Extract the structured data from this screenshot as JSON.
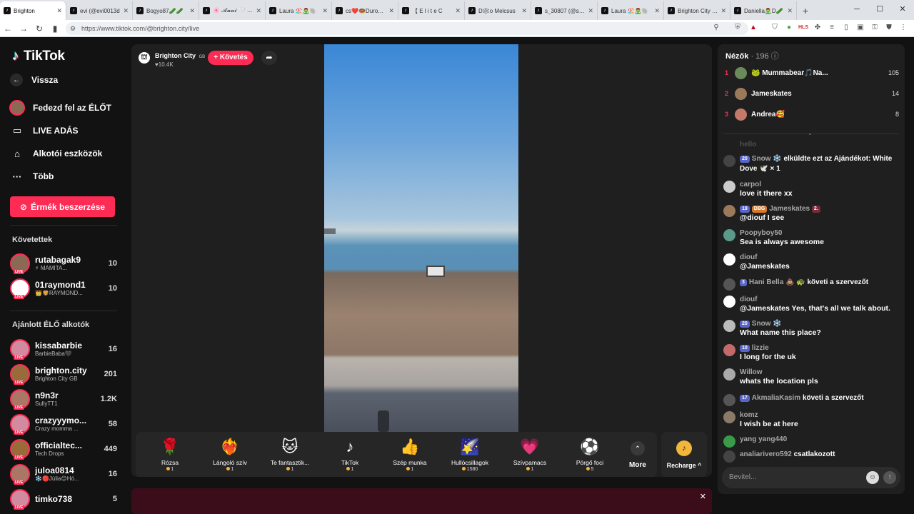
{
  "browser": {
    "tabs": [
      {
        "title": "Brighton",
        "active": true
      },
      {
        "title": "evi (@evi0013d"
      },
      {
        "title": "Bogyo87🥒🥒"
      },
      {
        "title": "🌸 𝓐𝓷𝓷𝓲 🤍 🌸"
      },
      {
        "title": "Laura 🏖️🧟‍♂️🐘"
      },
      {
        "title": "cs❤️🍩Duroka❤️"
      },
      {
        "title": "【 E l i t e C"
      },
      {
        "title": "D🕸️o Melcsus"
      },
      {
        "title": "s_30807 (@s_30"
      },
      {
        "title": "Laura 🏖️🧟‍♂️🐘"
      },
      {
        "title": "Brighton City oa"
      },
      {
        "title": "Daniella🧟‍♂️D🥒"
      }
    ],
    "url": "https://www.tiktok.com/@brighton.city/live"
  },
  "sidebar": {
    "logo": "TikTok",
    "back": "Vissza",
    "explore": "Fedezd fel az ÉLŐT",
    "live": "LIVE ADÁS",
    "creator_tools": "Alkotói eszközök",
    "more": "Több",
    "coins_button": "Érmék beszerzése",
    "following_title": "Követettek",
    "following": [
      {
        "name": "rutabagak9",
        "sub": "⚡ MAMITA...",
        "count": "10"
      },
      {
        "name": "01raymond1",
        "sub": "👑🦁RAYMOND...",
        "count": "10"
      }
    ],
    "recommended_title": "Ajánlott ÉLŐ alkotók",
    "recommended": [
      {
        "name": "kissabarbie",
        "sub": "BarbieBaba🖤",
        "count": "16"
      },
      {
        "name": "brighton.city",
        "sub": "Brighton City GB",
        "count": "201"
      },
      {
        "name": "n9n3r",
        "sub": "SullyTT1",
        "count": "1.2K"
      },
      {
        "name": "crazyyymo...",
        "sub": "Crazy momma ...",
        "count": "58"
      },
      {
        "name": "officialtec...",
        "sub": "Tech Drops",
        "count": "449"
      },
      {
        "name": "juloa0814",
        "sub": "❄️🔴Júlia😊Hó...",
        "count": "16"
      },
      {
        "name": "timko738",
        "sub": "",
        "count": "5"
      }
    ]
  },
  "stream": {
    "name": "Brighton City",
    "flag": "GB",
    "likes": "10.4K",
    "follow": "+ Követés"
  },
  "gifts": [
    {
      "name": "Rózsa",
      "icon": "🌹",
      "price": "1"
    },
    {
      "name": "Lángoló szív",
      "icon": "❤️‍🔥",
      "price": "1"
    },
    {
      "name": "Te fantasztik...",
      "icon": "🐱",
      "price": "1"
    },
    {
      "name": "TikTok",
      "icon": "♪",
      "price": "1"
    },
    {
      "name": "Szép munka",
      "icon": "👍",
      "price": "1"
    },
    {
      "name": "Hullócsillagok",
      "icon": "🌠",
      "price": "1580"
    },
    {
      "name": "Szívpamacs",
      "icon": "💗",
      "price": "1"
    },
    {
      "name": "Pörgő foci",
      "icon": "⚽",
      "price": "5"
    }
  ],
  "more_label": "More",
  "recharge_label": "Recharge ^",
  "viewers": {
    "title": "Nézők",
    "count": "196",
    "top": [
      {
        "rank": "1",
        "name": "🐸 Mummabear🎵Na...",
        "score": "105"
      },
      {
        "rank": "2",
        "name": "Jameskates",
        "score": "14"
      },
      {
        "rank": "3",
        "name": "Andrea🥰",
        "score": "8"
      }
    ]
  },
  "chat": [
    {
      "type": "faded",
      "text": "hello"
    },
    {
      "type": "gift",
      "badge": "20",
      "who": "Snow ❄️",
      "text": "elküldte ezt az Ajándékot: White Dove 🕊️ × 1"
    },
    {
      "type": "msg",
      "who": "carpol",
      "text": "love it there xx"
    },
    {
      "type": "msg",
      "badge": "19",
      "badge2": "DBG",
      "who": "Jameskates",
      "badge3": "2.",
      "text": "@diouf I see"
    },
    {
      "type": "msg",
      "who": "Poopyboy50",
      "text": "Sea is always awesome"
    },
    {
      "type": "msg",
      "who": "diouf",
      "text": "@Jameskates"
    },
    {
      "type": "sys",
      "badge": "3",
      "who": "Hani Bella 💩 🐢",
      "text": "követi a szervezőt"
    },
    {
      "type": "msg",
      "who": "diouf",
      "text": "@Jameskates Yes, that's all we talk about."
    },
    {
      "type": "msg",
      "badge": "20",
      "who": "Snow ❄️",
      "text": "What name this place?"
    },
    {
      "type": "msg",
      "badge": "10",
      "who": "lizzie",
      "text": "I long for the uk"
    },
    {
      "type": "msg",
      "who": "Willow",
      "text": "whats the location pls"
    },
    {
      "type": "sys",
      "badge": "17",
      "who": "AkmaliaKasim",
      "text": "követi a szervezőt"
    },
    {
      "type": "msg",
      "who": "komz",
      "text": "I wish be at here"
    },
    {
      "type": "msg",
      "who": "yang yang440",
      "text": ""
    },
    {
      "type": "sys",
      "who": "analiarivero592",
      "text": "csatlakozott"
    }
  ],
  "chat_input_placeholder": "Bevitel..."
}
